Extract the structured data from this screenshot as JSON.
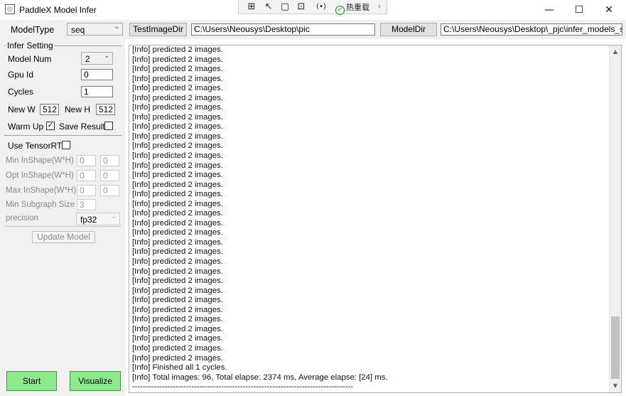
{
  "window": {
    "title": "PaddleX Model Infer",
    "controls": {
      "minimize": "—",
      "maximize": "☐",
      "close": "✕"
    }
  },
  "debug_toolbar": {
    "icons": [
      "select-element-icon",
      "pointer-icon",
      "frame-icon",
      "track-focus-icon",
      "binding-icon"
    ],
    "hot_reload_label": "热重载",
    "collapse": "‹"
  },
  "top_bar": {
    "model_type_label": "ModelType",
    "model_type_value": "seq",
    "test_image_dir_button": "TestImageDir",
    "test_image_dir_value": "C:\\Users\\Neousys\\Desktop\\pic",
    "model_dir_button": "ModelDir",
    "model_dir_value": "C:\\Users\\Neousys\\Desktop\\_pjc\\infer_models_seg"
  },
  "infer_setting": {
    "group_label": "Infer Setting",
    "model_num_label": "Model Num",
    "model_num_value": "2",
    "gpu_id_label": "Gpu Id",
    "gpu_id_value": "0",
    "cycles_label": "Cycles",
    "cycles_value": "1",
    "new_w_label": "New W",
    "new_w_value": "512",
    "new_h_label": "New H",
    "new_h_value": "512",
    "warm_up_label": "Warm Up",
    "warm_up_checked": true,
    "save_result_label": "Save Result",
    "save_result_checked": false
  },
  "tensorrt": {
    "use_label": "Use TensorRT",
    "use_checked": false,
    "min_inshape_label": "Min InShape(W*H)",
    "min_inshape_w": "0",
    "min_inshape_h": "0",
    "opt_inshape_label": "Opt InShape(W*H)",
    "opt_inshape_w": "0",
    "opt_inshape_h": "0",
    "max_inshape_label": "Max InShape(W*H)",
    "max_inshape_w": "0",
    "max_inshape_h": "0",
    "min_subgraph_label": "Min Subgraph Size",
    "min_subgraph_value": "3",
    "precision_label": "precision",
    "precision_value": "fp32",
    "update_model_button": "Update Model"
  },
  "log": {
    "lines": [
      "[Info] predicted 2 images.",
      "[Info] predicted 2 images.",
      "[Info] predicted 2 images.",
      "[Info] predicted 2 images.",
      "[Info] predicted 2 images.",
      "[Info] predicted 2 images.",
      "[Info] predicted 2 images.",
      "[Info] predicted 2 images.",
      "[Info] predicted 2 images.",
      "[Info] predicted 2 images.",
      "[Info] predicted 2 images.",
      "[Info] predicted 2 images.",
      "[Info] predicted 2 images.",
      "[Info] predicted 2 images.",
      "[Info] predicted 2 images.",
      "[Info] predicted 2 images.",
      "[Info] predicted 2 images.",
      "[Info] predicted 2 images.",
      "[Info] predicted 2 images.",
      "[Info] predicted 2 images.",
      "[Info] predicted 2 images.",
      "[Info] predicted 2 images.",
      "[Info] predicted 2 images.",
      "[Info] predicted 2 images.",
      "[Info] predicted 2 images.",
      "[Info] predicted 2 images.",
      "[Info] predicted 2 images.",
      "[Info] predicted 2 images.",
      "[Info] predicted 2 images.",
      "[Info] predicted 2 images.",
      "[Info] predicted 2 images.",
      "[Info] predicted 2 images.",
      "[Info] predicted 2 images.",
      "[Info] Finished all 1 cycles.",
      "[Info] Total images: 96, Total elapse: 2374 ms, Average elapse: [24] ms.",
      "----------------------------------------------------------------------------------"
    ],
    "scroll_up": "▲",
    "scroll_down": "▼"
  },
  "actions": {
    "start_button": "Start",
    "visualize_button": "Visualize"
  },
  "colors": {
    "action_button_bg": "#8ee88e",
    "panel_bg": "#f0f0f0",
    "hot_reload_check": "#1a8c1a"
  }
}
